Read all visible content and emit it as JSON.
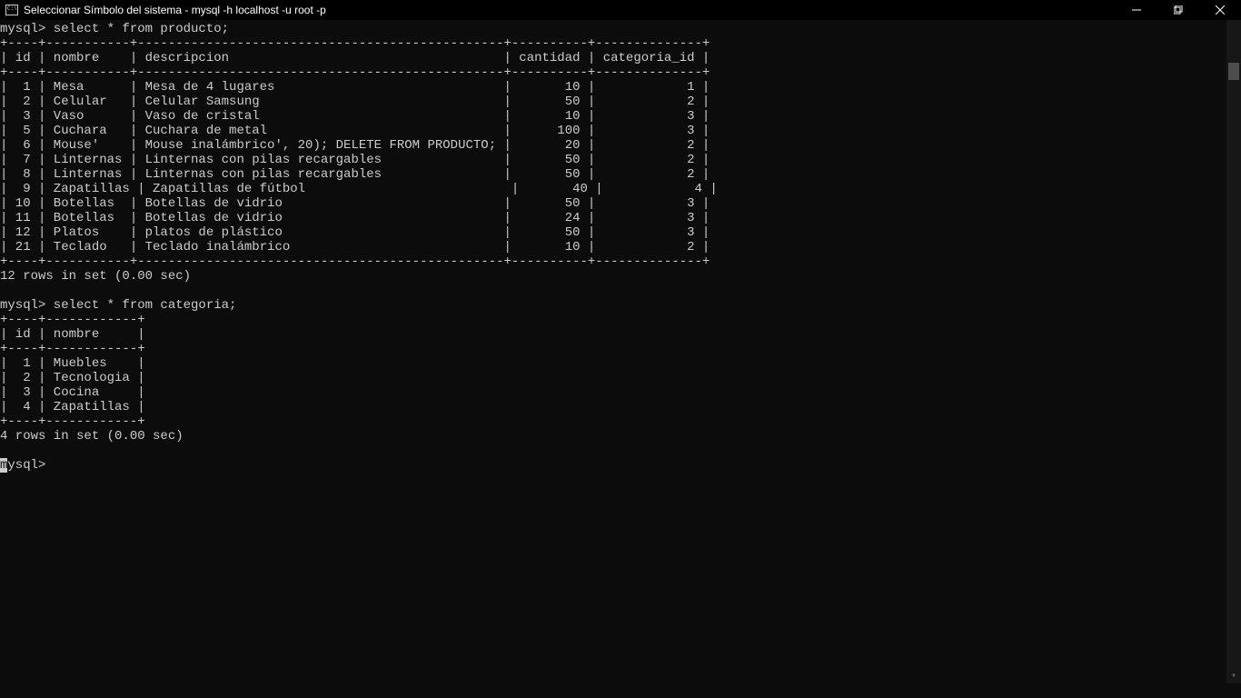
{
  "window": {
    "title": "Seleccionar Símbolo del sistema - mysql  -h localhost -u root -p"
  },
  "terminal": {
    "prompt1": "mysql> select * from producto;",
    "border1": "+----+-----------+------------------------------------------------+----------+--------------+",
    "header1": "| id | nombre    | descripcion                                    | cantidad | categoria_id |",
    "producto_rows": [
      "|  1 | Mesa      | Mesa de 4 lugares                              |       10 |            1 |",
      "|  2 | Celular   | Celular Samsung                                |       50 |            2 |",
      "|  3 | Vaso      | Vaso de cristal                                |       10 |            3 |",
      "|  5 | Cuchara   | Cuchara de metal                               |      100 |            3 |",
      "|  6 | Mouse'    | Mouse inalámbrico', 20); DELETE FROM PRODUCTO; |       20 |            2 |",
      "|  7 | Linternas | Linternas con pilas recargables                |       50 |            2 |",
      "|  8 | Linternas | Linternas con pilas recargables                |       50 |            2 |",
      "|  9 | Zapatillas | Zapatillas de fútbol                           |       40 |            4 |",
      "| 10 | Botellas  | Botellas de vidrio                             |       50 |            3 |",
      "| 11 | Botellas  | Botellas de vidrio                             |       24 |            3 |",
      "| 12 | Platos    | platos de plástico                             |       50 |            3 |",
      "| 21 | Teclado   | Teclado inalámbrico                            |       10 |            2 |"
    ],
    "result1": "12 rows in set (0.00 sec)",
    "prompt2": "mysql> select * from categoria;",
    "border2": "+----+------------+",
    "header2": "| id | nombre     |",
    "categoria_rows": [
      "|  1 | Muebles    |",
      "|  2 | Tecnologia |",
      "|  3 | Cocina     |",
      "|  4 | Zapatillas |"
    ],
    "result2": "4 rows in set (0.00 sec)",
    "prompt3_pre": "m",
    "prompt3_post": "ysql>"
  }
}
